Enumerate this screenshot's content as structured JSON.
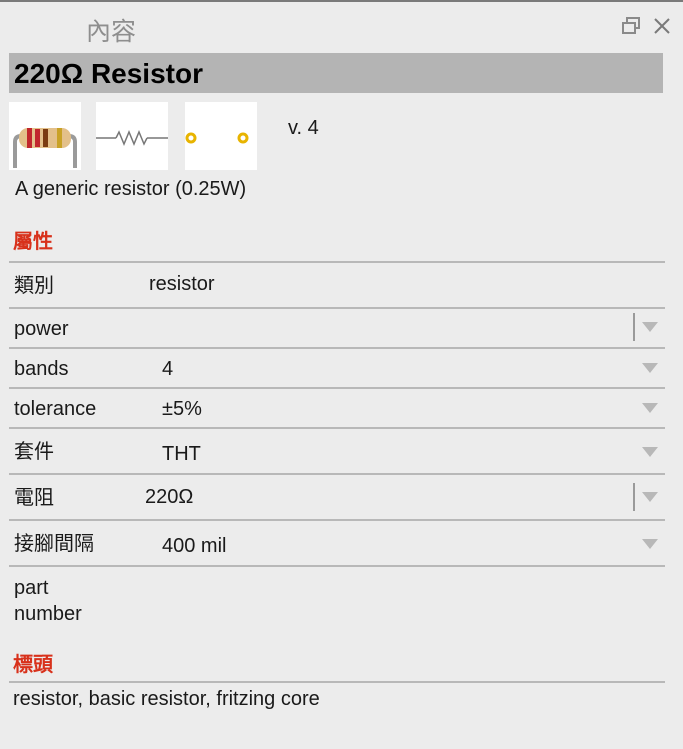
{
  "dock": {
    "title": "內容",
    "float_icon": "float-window-icon",
    "close_icon": "close-icon"
  },
  "part": {
    "title": "220Ω Resistor",
    "version": "v. 4",
    "description": "A generic resistor (0.25W)",
    "views": [
      "breadboard-view",
      "schematic-view",
      "pcb-view"
    ]
  },
  "properties": {
    "section_title": "屬性",
    "rows": [
      {
        "label": "類別",
        "value": "resistor"
      },
      {
        "label": "power",
        "value": ""
      },
      {
        "label": "bands",
        "value": "4"
      },
      {
        "label": "tolerance",
        "value": "±5%"
      },
      {
        "label": "套件",
        "value": "THT"
      },
      {
        "label": "電阻",
        "value": "220Ω"
      },
      {
        "label": "接腳間隔",
        "value": "400 mil"
      },
      {
        "label": "part\nnumber",
        "value": ""
      }
    ]
  },
  "tags": {
    "section_title": "標頭",
    "text": "resistor, basic resistor, fritzing core"
  },
  "colors": {
    "section_title": "#d8311b",
    "title_bar": "#b4b4b4",
    "background": "#ececec"
  }
}
